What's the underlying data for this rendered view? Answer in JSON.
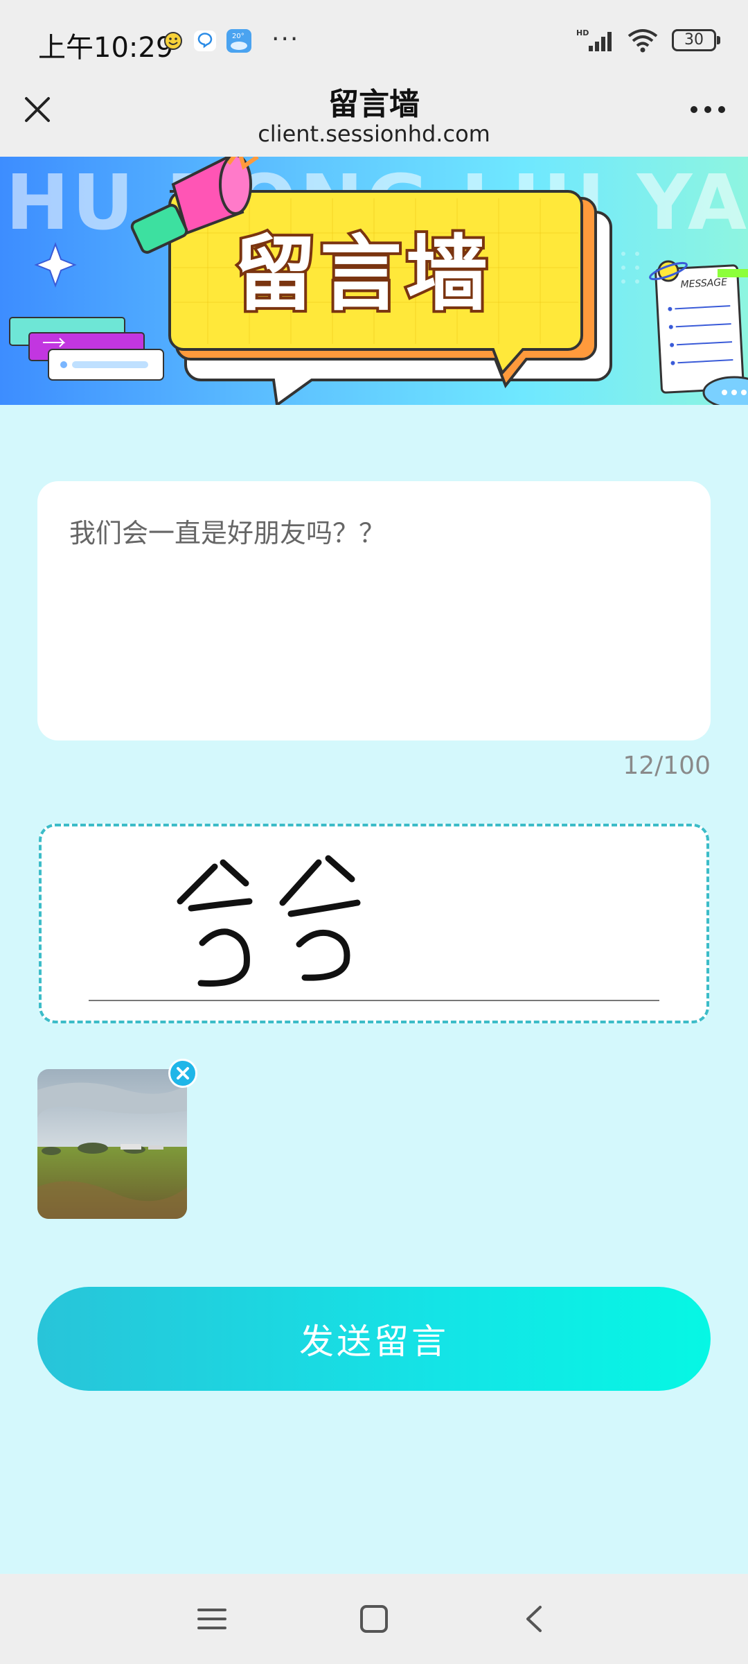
{
  "status_bar": {
    "time": "上午10:29",
    "dots": "···",
    "battery": "30",
    "network_label": "HD"
  },
  "nav": {
    "title": "留言墙",
    "url": "client.sessionhd.com"
  },
  "banner": {
    "bg_text": "HU DONG LIU YAN QIANG",
    "title": "留言墙",
    "card_label": "MESSAGE"
  },
  "message": {
    "text": "我们会一直是好朋友吗？？",
    "count": "12/100"
  },
  "signature": {
    "handwriting": "兮兮"
  },
  "send_label": "发送留言",
  "colors": {
    "page_bg": "#d4f8fc",
    "accent": "#14e4e6",
    "dashed_border": "#3cbcc8"
  }
}
